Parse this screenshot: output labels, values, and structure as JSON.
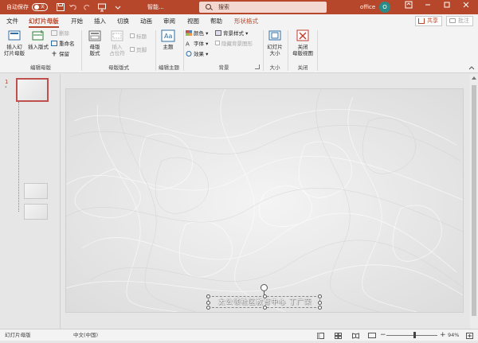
{
  "titlebar": {
    "autosave_label": "自动保存",
    "autosave_state": "关",
    "filename": "智能...",
    "search_placeholder": "搜索",
    "account": "office",
    "avatar_initial": "O"
  },
  "tabs": [
    {
      "label": "文件"
    },
    {
      "label": "幻灯片母版",
      "active": true
    },
    {
      "label": "开始"
    },
    {
      "label": "插入"
    },
    {
      "label": "切换"
    },
    {
      "label": "动画"
    },
    {
      "label": "审阅"
    },
    {
      "label": "视图"
    },
    {
      "label": "帮助"
    },
    {
      "label": "形状格式",
      "contextual": true
    }
  ],
  "share_label": "共享",
  "comment_label": "批注",
  "ribbon": {
    "groups": {
      "edit_master": "编辑母版",
      "master_layout": "母版版式",
      "edit_theme": "编辑主题",
      "background": "背景",
      "size": "大小",
      "close": "关闭"
    },
    "insert_slide_master": "插入幻\n灯片母版",
    "insert_layout": "插入版式",
    "delete": "删除",
    "rename": "重命名",
    "preserve": "保留",
    "master_layout_btn": "母版\n版式",
    "insert_placeholder": "插入\n占位符",
    "title_chk": "标题",
    "footer_chk": "页脚",
    "themes": "主题",
    "colors": "颜色",
    "fonts": "字体",
    "effects": "效果",
    "bg_styles": "背景样式",
    "hide_bg": "隐藏背景图形",
    "slide_size": "幻灯片\n大小",
    "close_master": "关闭\n母版视图"
  },
  "thumbnails": {
    "number": "1",
    "star": "*"
  },
  "slide": {
    "footer_text": "太公领社区教育中心 丁广荣"
  },
  "status": {
    "view_name": "幻灯片母版",
    "language": "中文(中国)",
    "zoom": "94%",
    "zoom_level": 0.55
  },
  "colors": {
    "brand": "#b7472a",
    "accent_avatar": "#2a8c88"
  }
}
